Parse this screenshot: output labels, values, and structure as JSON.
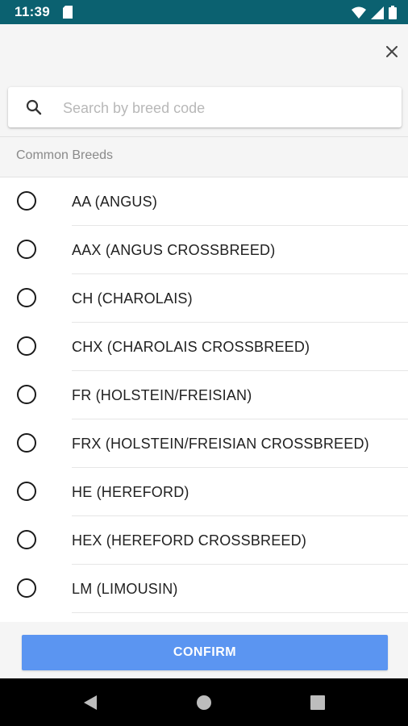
{
  "status_bar": {
    "time": "11:39",
    "icons": [
      "sd-card-icon",
      "wifi-icon",
      "signal-icon",
      "battery-icon"
    ]
  },
  "search": {
    "placeholder": "Search by breed code",
    "value": ""
  },
  "section_header": "Common Breeds",
  "breeds": [
    {
      "label": "AA (ANGUS)",
      "selected": false
    },
    {
      "label": "AAX (ANGUS CROSSBREED)",
      "selected": false
    },
    {
      "label": "CH (CHAROLAIS)",
      "selected": false
    },
    {
      "label": "CHX (CHAROLAIS CROSSBREED)",
      "selected": false
    },
    {
      "label": "FR (HOLSTEIN/FREISIAN)",
      "selected": false
    },
    {
      "label": "FRX (HOLSTEIN/FREISIAN CROSSBREED)",
      "selected": false
    },
    {
      "label": "HE (HEREFORD)",
      "selected": false
    },
    {
      "label": "HEX (HEREFORD CROSSBREED)",
      "selected": false
    },
    {
      "label": "LM (LIMOUSIN)",
      "selected": false
    }
  ],
  "confirm_label": "CONFIRM",
  "colors": {
    "status_bar": "#0b6170",
    "accent": "#5b95f1",
    "background": "#f5f5f5"
  }
}
